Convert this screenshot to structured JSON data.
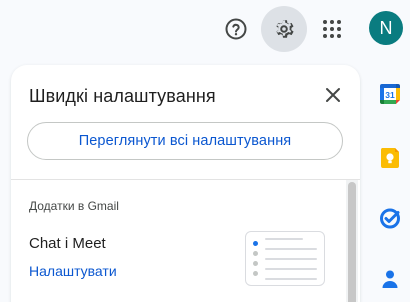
{
  "header": {
    "avatar_initial": "N",
    "avatar_color": "#0a7c80",
    "icons": [
      "help-icon",
      "settings-icon",
      "apps-grid-icon"
    ]
  },
  "quick_settings": {
    "title": "Швидкі налаштування",
    "see_all_label": "Переглянути всі налаштування",
    "section_title": "Додатки в Gmail",
    "item": {
      "title": "Chat і Meet",
      "action_label": "Налаштувати"
    }
  },
  "side_panel": {
    "apps": [
      "calendar-icon",
      "keep-icon",
      "tasks-icon",
      "contacts-icon"
    ],
    "calendar_day": "31"
  },
  "colors": {
    "accent": "#0b57d0",
    "settings_active_bg": "#dde1e6"
  }
}
